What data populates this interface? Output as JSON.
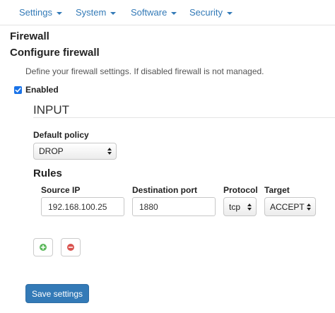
{
  "nav": {
    "items": [
      {
        "label": "Settings"
      },
      {
        "label": "System"
      },
      {
        "label": "Software"
      },
      {
        "label": "Security"
      }
    ]
  },
  "page": {
    "title": "Firewall",
    "subtitle": "Configure firewall",
    "description": "Define your firewall settings. If disabled firewall is not managed.",
    "enabled_label": "Enabled",
    "enabled_checked": true
  },
  "chain": {
    "name": "INPUT",
    "default_policy_label": "Default policy",
    "default_policy_value": "DROP"
  },
  "rules": {
    "heading": "Rules",
    "columns": {
      "source_ip": "Source IP",
      "destination_port": "Destination port",
      "protocol": "Protocol",
      "target": "Target"
    },
    "rows": [
      {
        "source_ip": "192.168.100.25",
        "destination_port": "1880",
        "protocol": "tcp",
        "target": "ACCEPT"
      }
    ],
    "add_icon": "plus-circle-icon",
    "remove_icon": "minus-circle-icon"
  },
  "actions": {
    "save_label": "Save settings"
  },
  "colors": {
    "link": "#337ab7",
    "primary": "#337ab7",
    "add": "#5cb85c",
    "remove": "#d9534f",
    "checkbox": "#1a73e8"
  }
}
